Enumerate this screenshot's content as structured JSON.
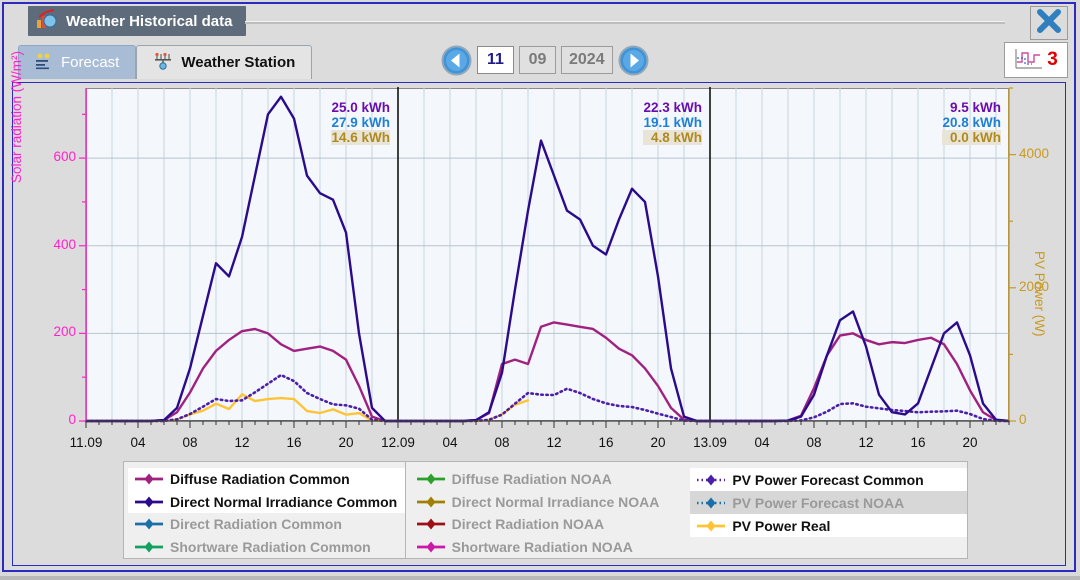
{
  "window": {
    "title": "Weather Historical data",
    "title_icon": "chart-weather-icon",
    "close_icon": "close-icon"
  },
  "tabs": [
    {
      "label": "Forecast",
      "icon": "forecast-icon",
      "selected": true
    },
    {
      "label": "Weather Station",
      "icon": "weather-station-icon",
      "selected": false
    }
  ],
  "date_nav": {
    "prev_icon": "chevron-left-icon",
    "next_icon": "chevron-right-icon",
    "day": "11",
    "month": "09",
    "year": "2024"
  },
  "badge": {
    "icon": "chart-lines-icon",
    "count": "3"
  },
  "chart_data": {
    "type": "line",
    "title": "",
    "xlabel": "",
    "ylabel": "Solar radiation (W/m²)",
    "ylabel_right": "PV Power (W)",
    "ylim": [
      0,
      760
    ],
    "ylim_right": [
      0,
      5000
    ],
    "yticks": [
      "0",
      "200",
      "400",
      "600"
    ],
    "ytick_values": [
      0,
      200,
      400,
      600
    ],
    "yticks_right": [
      "0",
      "2000",
      "4000"
    ],
    "ytick_right_values": [
      0,
      2000,
      4000
    ],
    "grid": true,
    "legend_position": "bottom",
    "xticks": [
      "11.09",
      "04",
      "08",
      "12",
      "16",
      "20",
      "12.09",
      "04",
      "08",
      "12",
      "16",
      "20",
      "13.09",
      "04",
      "08",
      "12",
      "16",
      "20"
    ],
    "day_boundaries": [
      "11.09",
      "12.09",
      "13.09"
    ],
    "day_totals": [
      {
        "day": "11.09",
        "pv_forecast_common": "25.0 kWh",
        "pv_forecast_noaa": "27.9 kWh",
        "pv_real": "14.6 kWh"
      },
      {
        "day": "12.09",
        "pv_forecast_common": "22.3 kWh",
        "pv_forecast_noaa": "19.1 kWh",
        "pv_real": "4.8 kWh"
      },
      {
        "day": "13.09",
        "pv_forecast_common": "9.5 kWh",
        "pv_forecast_noaa": "20.8 kWh",
        "pv_real": "0.0 kWh"
      }
    ],
    "x": [
      0,
      1,
      2,
      3,
      4,
      5,
      6,
      7,
      8,
      9,
      10,
      11,
      12,
      13,
      14,
      15,
      16,
      17,
      18,
      19,
      20,
      21,
      22,
      23,
      24,
      25,
      26,
      27,
      28,
      29,
      30,
      31,
      32,
      33,
      34,
      35,
      36,
      37,
      38,
      39,
      40,
      41,
      42,
      43,
      44,
      45,
      46,
      47,
      48,
      49,
      50,
      51,
      52,
      53,
      54,
      55,
      56,
      57,
      58,
      59,
      60,
      61,
      62,
      63,
      64,
      65,
      66,
      67,
      68,
      69,
      70,
      71
    ],
    "series": [
      {
        "name": "Direct Normal Irradiance Common",
        "color": "#2b0b8c",
        "style": "solid",
        "axis": "left",
        "values": [
          0,
          0,
          0,
          0,
          0,
          0,
          2,
          30,
          120,
          240,
          360,
          330,
          420,
          560,
          700,
          740,
          690,
          560,
          520,
          505,
          430,
          200,
          30,
          0,
          0,
          0,
          0,
          0,
          0,
          0,
          2,
          20,
          110,
          300,
          480,
          640,
          560,
          480,
          460,
          400,
          380,
          460,
          530,
          500,
          330,
          120,
          10,
          0,
          0,
          0,
          0,
          0,
          0,
          0,
          1,
          10,
          60,
          150,
          230,
          250,
          170,
          60,
          20,
          15,
          40,
          120,
          200,
          225,
          150,
          40,
          3,
          0
        ]
      },
      {
        "name": "PV Power Forecast Common",
        "color": "#4b1fa8",
        "style": "dotted",
        "axis": "right",
        "values": [
          0,
          0,
          0,
          0,
          0,
          0,
          1,
          25,
          105,
          215,
          330,
          300,
          310,
          430,
          560,
          690,
          600,
          420,
          330,
          250,
          235,
          185,
          20,
          0,
          0,
          0,
          0,
          0,
          0,
          0,
          1,
          18,
          95,
          260,
          420,
          395,
          390,
          485,
          420,
          330,
          265,
          225,
          210,
          165,
          110,
          60,
          5,
          0,
          0,
          0,
          0,
          0,
          0,
          0,
          1,
          8,
          55,
          140,
          255,
          265,
          215,
          190,
          165,
          150,
          130,
          140,
          145,
          155,
          105,
          30,
          2,
          0
        ]
      },
      {
        "name": "Diffuse Radiation Common",
        "color": "#a0217f",
        "style": "solid",
        "axis": "left",
        "values": [
          0,
          0,
          0,
          0,
          0,
          0,
          2,
          20,
          65,
          120,
          160,
          185,
          205,
          210,
          200,
          175,
          160,
          165,
          170,
          160,
          140,
          80,
          10,
          0,
          0,
          0,
          0,
          0,
          0,
          0,
          2,
          18,
          130,
          140,
          130,
          215,
          225,
          220,
          215,
          210,
          190,
          165,
          150,
          120,
          80,
          30,
          3,
          0,
          0,
          0,
          0,
          0,
          0,
          0,
          1,
          12,
          75,
          150,
          195,
          200,
          185,
          175,
          180,
          178,
          185,
          190,
          175,
          130,
          70,
          20,
          2,
          0
        ]
      },
      {
        "name": "PV Power Real",
        "color": "#ffc436",
        "style": "solid",
        "axis": "right",
        "values": [
          0,
          0,
          0,
          0,
          0,
          0,
          1,
          20,
          100,
          155,
          260,
          180,
          400,
          300,
          330,
          345,
          330,
          150,
          120,
          175,
          95,
          120,
          5,
          0,
          0,
          0,
          0,
          0,
          0,
          0,
          1,
          15,
          100,
          245,
          310,
          null,
          null,
          null,
          null,
          null,
          null,
          null,
          null,
          null,
          null,
          null,
          null,
          null,
          null,
          null,
          null,
          null,
          null,
          null,
          null,
          null,
          null,
          null,
          null,
          null,
          null,
          null,
          null,
          null,
          null,
          null,
          null,
          null,
          null,
          null,
          null,
          null
        ]
      }
    ]
  },
  "legend": {
    "columns": [
      {
        "items": [
          {
            "label": "Diffuse Radiation Common",
            "color": "#a0217f",
            "active": true,
            "highlight": false,
            "style": "solid"
          },
          {
            "label": "Direct Normal Irradiance Common",
            "color": "#2b0b8c",
            "active": true,
            "highlight": false,
            "style": "solid"
          },
          {
            "label": "Direct Radiation Common",
            "color": "#1a6fa8",
            "active": false,
            "highlight": false,
            "style": "solid"
          },
          {
            "label": "Shortware Radiation Common",
            "color": "#12a05f",
            "active": false,
            "highlight": false,
            "style": "solid"
          }
        ]
      },
      {
        "items": [
          {
            "label": "Diffuse Radiation NOAA",
            "color": "#2ca02c",
            "active": false,
            "highlight": false,
            "style": "solid"
          },
          {
            "label": "Direct Normal Irradiance NOAA",
            "color": "#a08000",
            "active": false,
            "highlight": false,
            "style": "solid"
          },
          {
            "label": "Direct Radiation NOAA",
            "color": "#9c1016",
            "active": false,
            "highlight": false,
            "style": "solid"
          },
          {
            "label": "Shortware Radiation NOAA",
            "color": "#cc1aa8",
            "active": false,
            "highlight": false,
            "style": "solid"
          }
        ]
      },
      {
        "items": [
          {
            "label": "PV Power Forecast Common",
            "color": "#4b1fa8",
            "active": true,
            "highlight": false,
            "style": "dotted"
          },
          {
            "label": "PV Power Forecast NOAA",
            "color": "#1a6fa8",
            "active": false,
            "highlight": true,
            "style": "dotted"
          },
          {
            "label": "PV Power Real",
            "color": "#ffc436",
            "active": true,
            "highlight": false,
            "style": "solid"
          }
        ]
      }
    ]
  }
}
